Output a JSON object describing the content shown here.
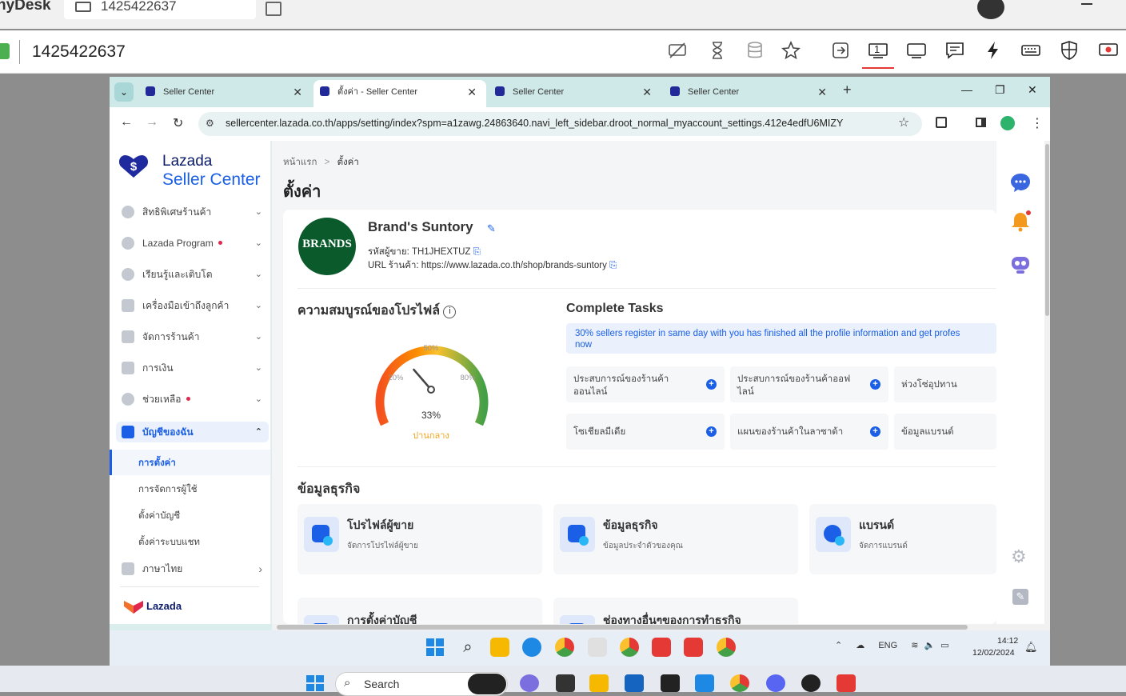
{
  "anydesk": {
    "brand": "nyDesk",
    "tab_id": "1425422637",
    "address_id": "1425422637",
    "toolbar_icons": [
      "privacy-icon",
      "hourglass-icon",
      "database-icon",
      "star-icon",
      "transfer-icon",
      "monitor-1-icon",
      "display-icon",
      "chat-icon",
      "lightning-icon",
      "keyboard-icon",
      "shield-icon",
      "record-icon"
    ],
    "monitor_number": "1"
  },
  "browser": {
    "tabs": [
      {
        "title": "Seller Center"
      },
      {
        "title": "ตั้งค่า - Seller Center"
      },
      {
        "title": "Seller Center"
      },
      {
        "title": "Seller Center"
      }
    ],
    "url": "sellercenter.lazada.co.th/apps/setting/index?spm=a1zawg.24863640.navi_left_sidebar.droot_normal_myaccount_settings.412e4edfU6MIZY",
    "new_tab": "+"
  },
  "sidebar": {
    "logo_line1": "Lazada",
    "logo_line2": "Seller Center",
    "items": [
      {
        "label": "สิทธิพิเศษร้านค้า"
      },
      {
        "label": "Lazada Program"
      },
      {
        "label": "เรียนรู้และเติบโต"
      },
      {
        "label": "เครื่องมือเข้าถึงลูกค้า"
      },
      {
        "label": "จัดการร้านค้า"
      },
      {
        "label": "การเงิน"
      },
      {
        "label": "ช่วยเหลือ"
      },
      {
        "label": "บัญชีของฉัน"
      }
    ],
    "subitems": [
      {
        "label": "การตั้งค่า"
      },
      {
        "label": "การจัดการผู้ใช้"
      },
      {
        "label": "ตั้งค่าบัญชี"
      },
      {
        "label": "ตั้งค่าระบบแชท"
      }
    ],
    "language": "ภาษาไทย",
    "footer_logo": "Lazada"
  },
  "main": {
    "breadcrumb_home": "หน้าแรก",
    "breadcrumb_sep": ">",
    "breadcrumb_current": "ตั้งค่า",
    "page_title": "ตั้งค่า",
    "brand": {
      "logo_text": "BRANDS",
      "name": "Brand's Suntory",
      "seller_id": "รหัสผู้ขาย: TH1JHEXTUZ",
      "shop_url": "URL ร้านค้า: https://www.lazada.co.th/shop/brands-suntory"
    },
    "profile_completeness": {
      "title": "ความสมบูรณ์ของโปรไฟล์",
      "percent_label": "33%",
      "percent": 33,
      "status": "ปานกลาง",
      "tick_20": "20%",
      "tick_50": "50%",
      "tick_80": "80%"
    },
    "complete_tasks": {
      "title": "Complete Tasks",
      "banner": "30% sellers register in same day with you has finished all the profile information and get profes",
      "banner_line2": "now",
      "tasks": [
        {
          "label": "ประสบการณ์ของร้านค้าออนไลน์"
        },
        {
          "label": "ประสบการณ์ของร้านค้าออฟไลน์"
        },
        {
          "label": "ห่วงโซ่อุปทาน"
        },
        {
          "label": "โซเชียลมีเดีย"
        },
        {
          "label": "แผนของร้านค้าในลาซาด้า"
        },
        {
          "label": "ข้อมูลแบรนด์"
        }
      ]
    },
    "business_info": {
      "title": "ข้อมูลธุรกิจ",
      "cards": [
        {
          "title": "โปรไฟล์ผู้ขาย",
          "subtitle": "จัดการโปรไฟล์ผู้ขาย"
        },
        {
          "title": "ข้อมูลธุรกิจ",
          "subtitle": "ข้อมูลประจำตัวของคุณ"
        },
        {
          "title": "แบรนด์",
          "subtitle": "จัดการแบรนด์"
        },
        {
          "title": "การตั้งค่าบัญชี",
          "subtitle": ""
        },
        {
          "title": "ช่องทางอื่นๆของการทำธุรกิจ",
          "subtitle": ""
        }
      ]
    }
  },
  "remote_taskbar": {
    "lang": "ENG",
    "time": "14:12",
    "date": "12/02/2024"
  },
  "local_taskbar": {
    "search_placeholder": "Search"
  },
  "colors": {
    "lazada_blue": "#1a5fe6",
    "lazada_navy": "#0c1c6b",
    "brand_green": "#0b5a2b",
    "gauge_status": "#f0a41c"
  }
}
